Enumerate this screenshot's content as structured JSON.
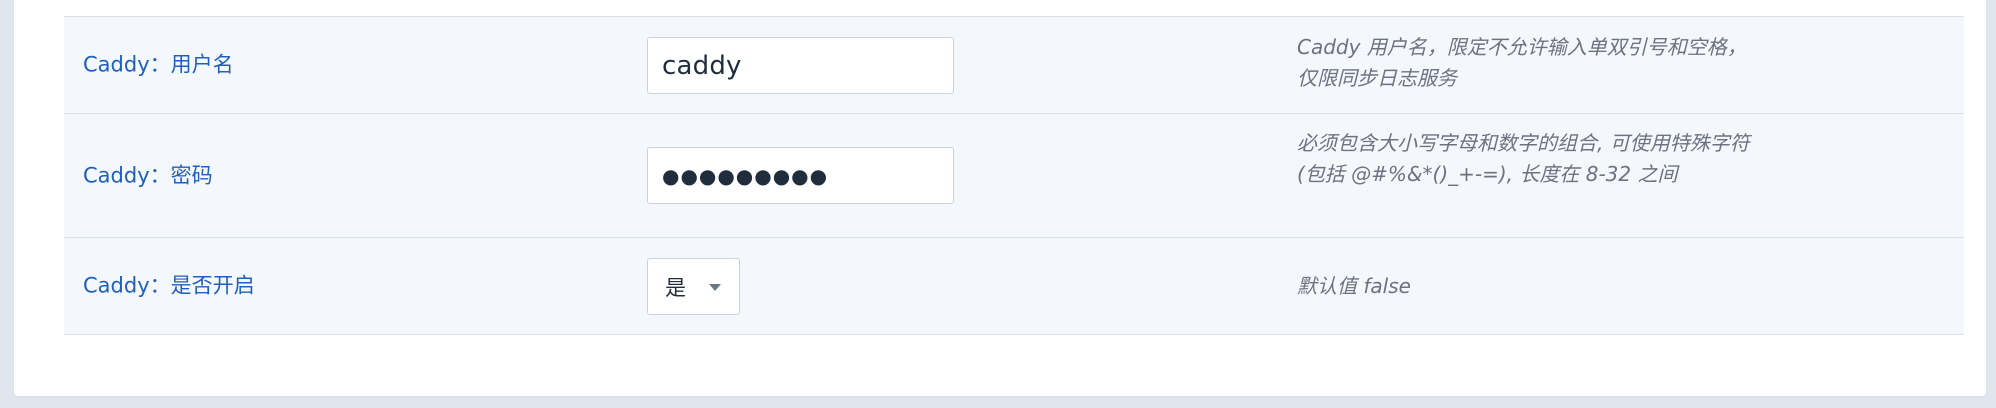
{
  "rows": [
    {
      "label": "Caddy：用户名",
      "value": "caddy",
      "help": "Caddy 用户名，限定不允许输入单双引号和空格，仅限同步日志服务"
    },
    {
      "label": "Caddy：密码",
      "value": "●●●●●●●●●",
      "help": "必须包含大小写字母和数字的组合, 可使用特殊字符(包括 @#%&*()_+-=), 长度在 8-32 之间"
    },
    {
      "label": "Caddy：是否开启",
      "value": "是",
      "help": "默认值 false"
    }
  ],
  "colors": {
    "label": "#1f5fbf",
    "row_background": "#f4f8fc",
    "border": "#d7e2ec",
    "help_text": "#6b7280"
  },
  "icons": {
    "select_caret": "chevron-down-icon"
  }
}
